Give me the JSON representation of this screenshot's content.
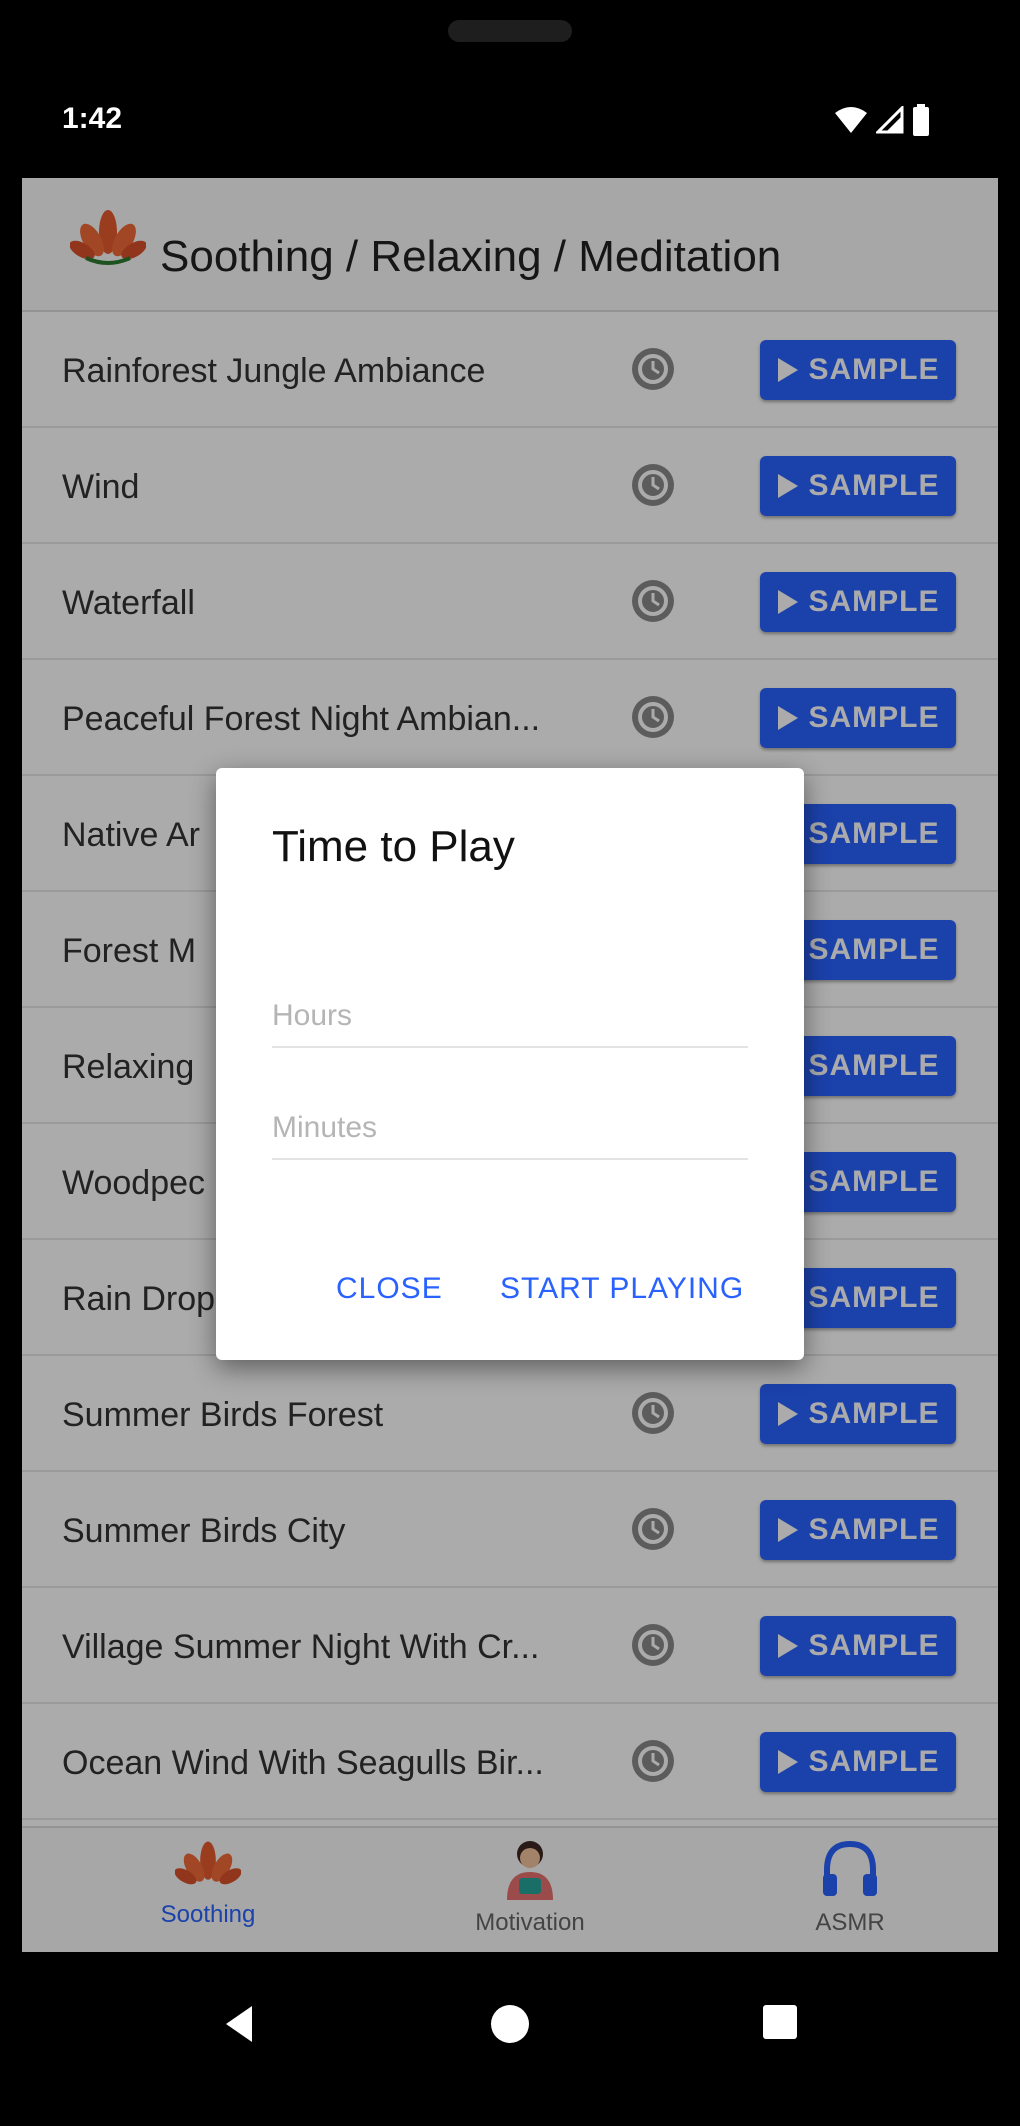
{
  "status_bar": {
    "time": "1:42"
  },
  "header": {
    "title": "Soothing / Relaxing / Meditation",
    "icon": "lotus-icon"
  },
  "sounds": [
    {
      "name": "Rainforest Jungle Ambiance",
      "button": "SAMPLE"
    },
    {
      "name": "Wind",
      "button": "SAMPLE"
    },
    {
      "name": "Waterfall",
      "button": "SAMPLE"
    },
    {
      "name": "Peaceful Forest Night Ambian...",
      "button": "SAMPLE"
    },
    {
      "name": "Native Ar",
      "button": "SAMPLE"
    },
    {
      "name": "Forest M",
      "button": "SAMPLE"
    },
    {
      "name": "Relaxing",
      "button": "SAMPLE"
    },
    {
      "name": "Woodpec",
      "button": "SAMPLE"
    },
    {
      "name": "Rain Drop",
      "button": "SAMPLE"
    },
    {
      "name": "Summer Birds Forest",
      "button": "SAMPLE"
    },
    {
      "name": "Summer Birds City",
      "button": "SAMPLE"
    },
    {
      "name": "Village Summer Night With Cr...",
      "button": "SAMPLE"
    },
    {
      "name": "Ocean Wind With Seagulls Bir...",
      "button": "SAMPLE"
    }
  ],
  "dialog": {
    "title": "Time to Play",
    "hours_placeholder": "Hours",
    "minutes_placeholder": "Minutes",
    "close_label": "CLOSE",
    "start_label": "START PLAYING"
  },
  "bottom_nav": [
    {
      "label": "Soothing",
      "icon": "lotus-icon",
      "active": true
    },
    {
      "label": "Motivation",
      "icon": "person-icon",
      "active": false
    },
    {
      "label": "ASMR",
      "icon": "headphones-icon",
      "active": false
    }
  ],
  "colors": {
    "accent": "#2962ff",
    "lotus": "#e65a2e"
  }
}
